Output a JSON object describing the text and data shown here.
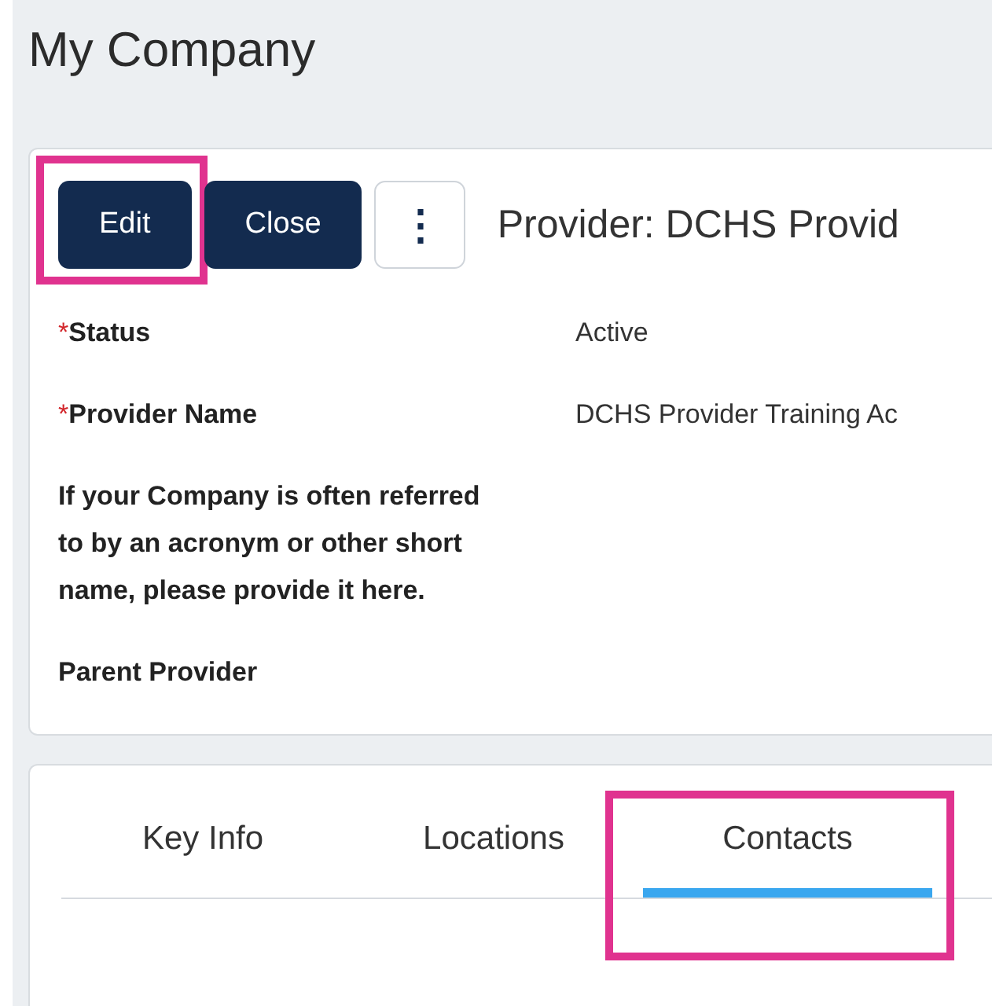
{
  "page_title": "My Company",
  "toolbar": [
    {
      "label": "Edit",
      "kind": "primary",
      "highlighted": true
    },
    {
      "label": "Close",
      "kind": "primary",
      "highlighted": false
    },
    {
      "label": "⋮",
      "kind": "menu",
      "highlighted": false
    }
  ],
  "record_title": "Provider: DCHS Provid",
  "fields": [
    {
      "label": "Status",
      "required_mark": "*",
      "value": "Active"
    },
    {
      "label": "Provider Name",
      "required_mark": "*",
      "value": "DCHS Provider Training Ac"
    },
    {
      "label": "If your Company is often referred to by an acronym or other short name, please provide it here."
    },
    {
      "label": "Parent Provider"
    }
  ],
  "tabs": [
    {
      "label": "Key Info",
      "selected": false,
      "highlighted": false
    },
    {
      "label": "Locations",
      "selected": false,
      "highlighted": false
    },
    {
      "label": "Contacts",
      "selected": true,
      "highlighted": true
    }
  ]
}
